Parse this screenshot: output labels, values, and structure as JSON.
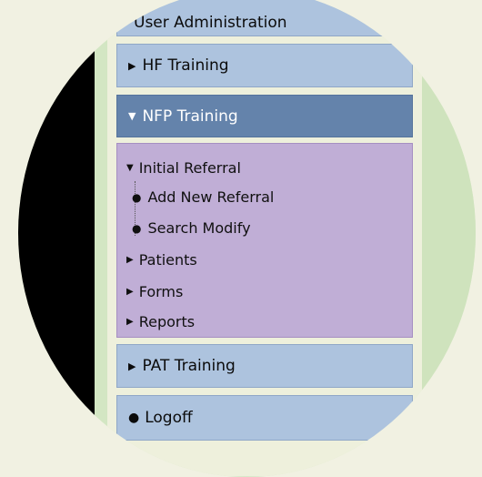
{
  "menu": {
    "top_partial": "User Administration",
    "hf_training": "HF Training",
    "nfp_training": "NFP Training",
    "nfp_items": {
      "initial_referral": "Initial Referral",
      "add_new_referral": "Add New Referral",
      "search_modify": "Search Modify",
      "patients": "Patients",
      "forms": "Forms",
      "reports": "Reports"
    },
    "pat_training": "PAT Training",
    "logoff": "Logoff"
  },
  "icons": {
    "collapsed": "triangle-right-icon",
    "expanded": "triangle-down-icon",
    "bullet": "bullet-icon"
  },
  "colors": {
    "menu_bar": "#adc3de",
    "menu_bar_active": "#6483ab",
    "submenu": "#c0aed6",
    "sidebar_bg": "#eef0dc"
  }
}
